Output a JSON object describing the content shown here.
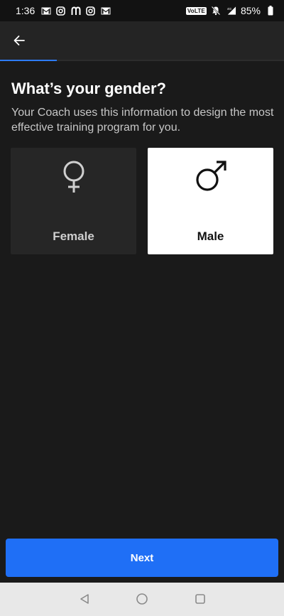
{
  "status_bar": {
    "time": "1:36",
    "network_badge": "VoLTE",
    "battery": "85%",
    "left_icons": [
      "gmail-icon",
      "instagram-icon",
      "m-app-icon",
      "instagram-icon",
      "gmail-icon"
    ],
    "right_icons": [
      "mute-bell-icon",
      "signal-4g-icon",
      "battery-icon"
    ]
  },
  "app_bar": {
    "back_icon": "back-arrow-icon",
    "progress": 0.2
  },
  "main": {
    "title": "What’s your gender?",
    "subtitle": "Your Coach uses this information to design the most effective training program for you.",
    "options": [
      {
        "label": "Female",
        "icon": "female-symbol-icon",
        "selected": false
      },
      {
        "label": "Male",
        "icon": "male-symbol-icon",
        "selected": true
      }
    ]
  },
  "footer": {
    "next_label": "Next"
  },
  "nav_bar": {
    "icons": [
      "nav-back-icon",
      "nav-home-icon",
      "nav-recents-icon"
    ]
  },
  "colors": {
    "background": "#1a1a1a",
    "app_bar": "#242424",
    "accent": "#1f6ff6",
    "unselected_card": "#262626",
    "selected_card": "#ffffff"
  }
}
